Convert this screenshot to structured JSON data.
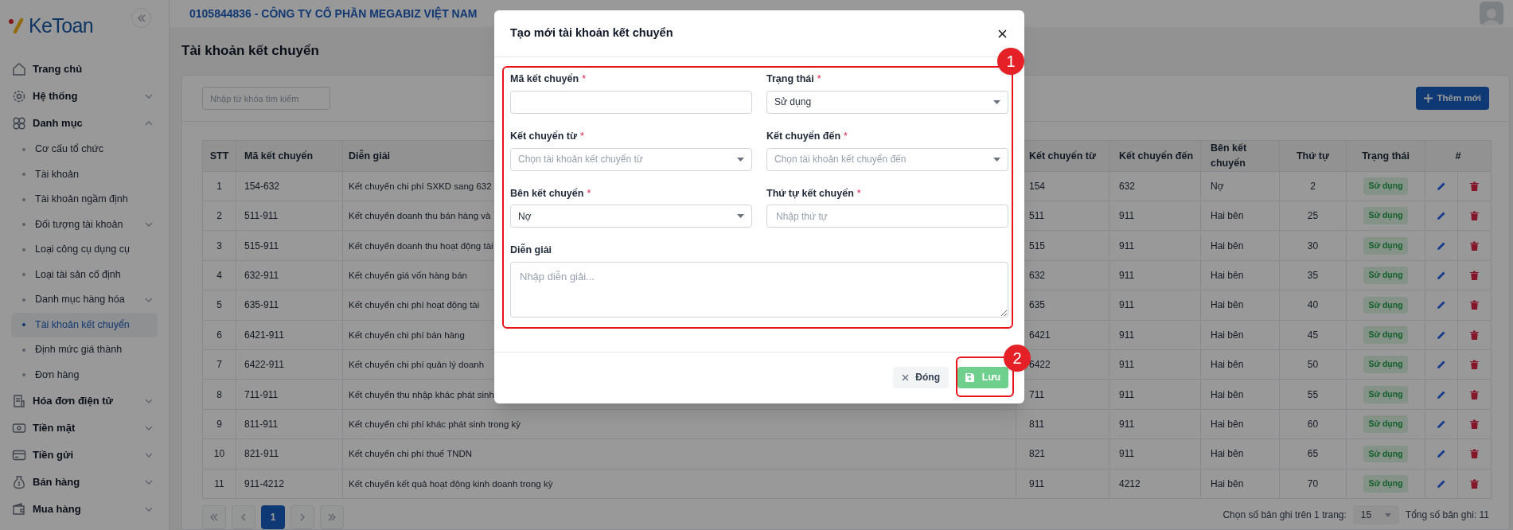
{
  "app": {
    "logo": "KeToan",
    "company": "0105844836 - CÔNG TY CỔ PHẦN MEGABIZ VIỆT NAM"
  },
  "sidebar": {
    "items": [
      {
        "label": "Trang chủ",
        "has_children": false
      },
      {
        "label": "Hệ thống",
        "has_children": true,
        "expanded": false
      },
      {
        "label": "Danh mục",
        "has_children": true,
        "expanded": true,
        "children": [
          {
            "label": "Cơ cấu tổ chức",
            "has_children": false,
            "selected": false
          },
          {
            "label": "Tài khoản",
            "has_children": false,
            "selected": false
          },
          {
            "label": "Tài khoản ngầm định",
            "has_children": false,
            "selected": false
          },
          {
            "label": "Đối tượng tài khoản",
            "has_children": true,
            "selected": false
          },
          {
            "label": "Loại công cụ dụng cụ",
            "has_children": false,
            "selected": false
          },
          {
            "label": "Loại tài sản cố định",
            "has_children": false,
            "selected": false
          },
          {
            "label": "Danh mục hàng hóa",
            "has_children": true,
            "selected": false
          },
          {
            "label": "Tài khoản kết chuyển",
            "has_children": false,
            "selected": true
          },
          {
            "label": "Định mức giá thành",
            "has_children": false,
            "selected": false
          },
          {
            "label": "Đơn hàng",
            "has_children": false,
            "selected": false
          }
        ]
      },
      {
        "label": "Hóa đơn điện tử",
        "has_children": true,
        "expanded": false
      },
      {
        "label": "Tiền mặt",
        "has_children": true,
        "expanded": false
      },
      {
        "label": "Tiền gửi",
        "has_children": true,
        "expanded": false
      },
      {
        "label": "Bán hàng",
        "has_children": true,
        "expanded": false
      },
      {
        "label": "Mua hàng",
        "has_children": true,
        "expanded": false
      }
    ]
  },
  "page": {
    "title": "Tài khoản kết chuyển",
    "search": {
      "placeholder": "Nhập từ khóa tìm kiếm"
    },
    "add_button": "Thêm mới"
  },
  "table": {
    "columns": [
      "STT",
      "Mã kết chuyển",
      "Diễn giải",
      "Kết chuyển từ",
      "Kết chuyển đến",
      "Bên kết chuyển",
      "Thứ tự",
      "Trạng thái",
      "#"
    ],
    "rows": [
      {
        "stt": "1",
        "code": "154-632",
        "description": "Kết chuyển chi phí SXKD sang 632",
        "from": "154",
        "to": "632",
        "side": "Nợ",
        "order": "2",
        "status": "Sử dụng"
      },
      {
        "stt": "2",
        "code": "511-911",
        "description": "Kết chuyển doanh thu bán hàng và",
        "from": "511",
        "to": "911",
        "side": "Hai bên",
        "order": "25",
        "status": "Sử dụng"
      },
      {
        "stt": "3",
        "code": "515-911",
        "description": "Kết chuyển doanh thu hoạt động tài",
        "from": "515",
        "to": "911",
        "side": "Hai bên",
        "order": "30",
        "status": "Sử dụng"
      },
      {
        "stt": "4",
        "code": "632-911",
        "description": "Kết chuyển giá vốn hàng bán",
        "from": "632",
        "to": "911",
        "side": "Hai bên",
        "order": "35",
        "status": "Sử dụng"
      },
      {
        "stt": "5",
        "code": "635-911",
        "description": "Kết chuyển chi phí hoạt động tài",
        "from": "635",
        "to": "911",
        "side": "Hai bên",
        "order": "40",
        "status": "Sử dụng"
      },
      {
        "stt": "6",
        "code": "6421-911",
        "description": "Kết chuyển chi phí bán hàng",
        "from": "6421",
        "to": "911",
        "side": "Hai bên",
        "order": "45",
        "status": "Sử dụng"
      },
      {
        "stt": "7",
        "code": "6422-911",
        "description": "Kết chuyển chi phí quản lý doanh",
        "from": "6422",
        "to": "911",
        "side": "Hai bên",
        "order": "50",
        "status": "Sử dụng"
      },
      {
        "stt": "8",
        "code": "711-911",
        "description": "Kết chuyển thu nhập khác phát sinh",
        "from": "711",
        "to": "911",
        "side": "Hai bên",
        "order": "55",
        "status": "Sử dụng"
      },
      {
        "stt": "9",
        "code": "811-911",
        "description": "Kết chuyển chi phí khác phát sinh trong kỳ",
        "from": "811",
        "to": "911",
        "side": "Hai bên",
        "order": "60",
        "status": "Sử dụng"
      },
      {
        "stt": "10",
        "code": "821-911",
        "description": "Kết chuyển chi phí thuế TNDN",
        "from": "821",
        "to": "911",
        "side": "Hai bên",
        "order": "65",
        "status": "Sử dụng"
      },
      {
        "stt": "11",
        "code": "911-4212",
        "description": "Kết chuyển kết quả hoạt động kinh doanh trong kỳ",
        "from": "911",
        "to": "4212",
        "side": "Hai bên",
        "order": "70",
        "status": "Sử dụng"
      }
    ]
  },
  "pagination": {
    "pages": [
      {
        "label": "1",
        "selected": true
      }
    ],
    "page_size_label": "Chọn số bản ghi trên 1 trang:",
    "page_size": "15",
    "total": "Tổng số bản ghi: 11"
  },
  "dialog": {
    "title": "Tạo mới tài khoản kết chuyển",
    "fields": [
      {
        "kind": "text",
        "label": "Mã kết chuyển",
        "required_mark": "*"
      },
      {
        "kind": "select",
        "label": "Trạng thái",
        "required_mark": "*",
        "value": "Sử dụng"
      },
      {
        "kind": "select",
        "label": "Kết chuyển từ",
        "required_mark": "*",
        "placeholder": "Chọn tài khoản kết chuyển từ"
      },
      {
        "kind": "select",
        "label": "Kết chuyển đến",
        "required_mark": "*",
        "placeholder": "Chọn tài khoản kết chuyển đến"
      },
      {
        "kind": "select",
        "label": "Bên kết chuyển",
        "required_mark": "*",
        "value": "Nợ"
      },
      {
        "kind": "text",
        "label": "Thứ tự kết chuyển",
        "required_mark": "*",
        "placeholder": "Nhập thứ tự"
      },
      {
        "kind": "textarea",
        "label": "Diễn giải",
        "placeholder": "Nhập diễn giải..."
      }
    ],
    "buttons": [
      {
        "kind": "cancel",
        "label": "Đóng"
      },
      {
        "kind": "save",
        "label": "Lưu"
      }
    ]
  },
  "annotations": [
    {
      "label": "1"
    },
    {
      "label": "2"
    }
  ]
}
